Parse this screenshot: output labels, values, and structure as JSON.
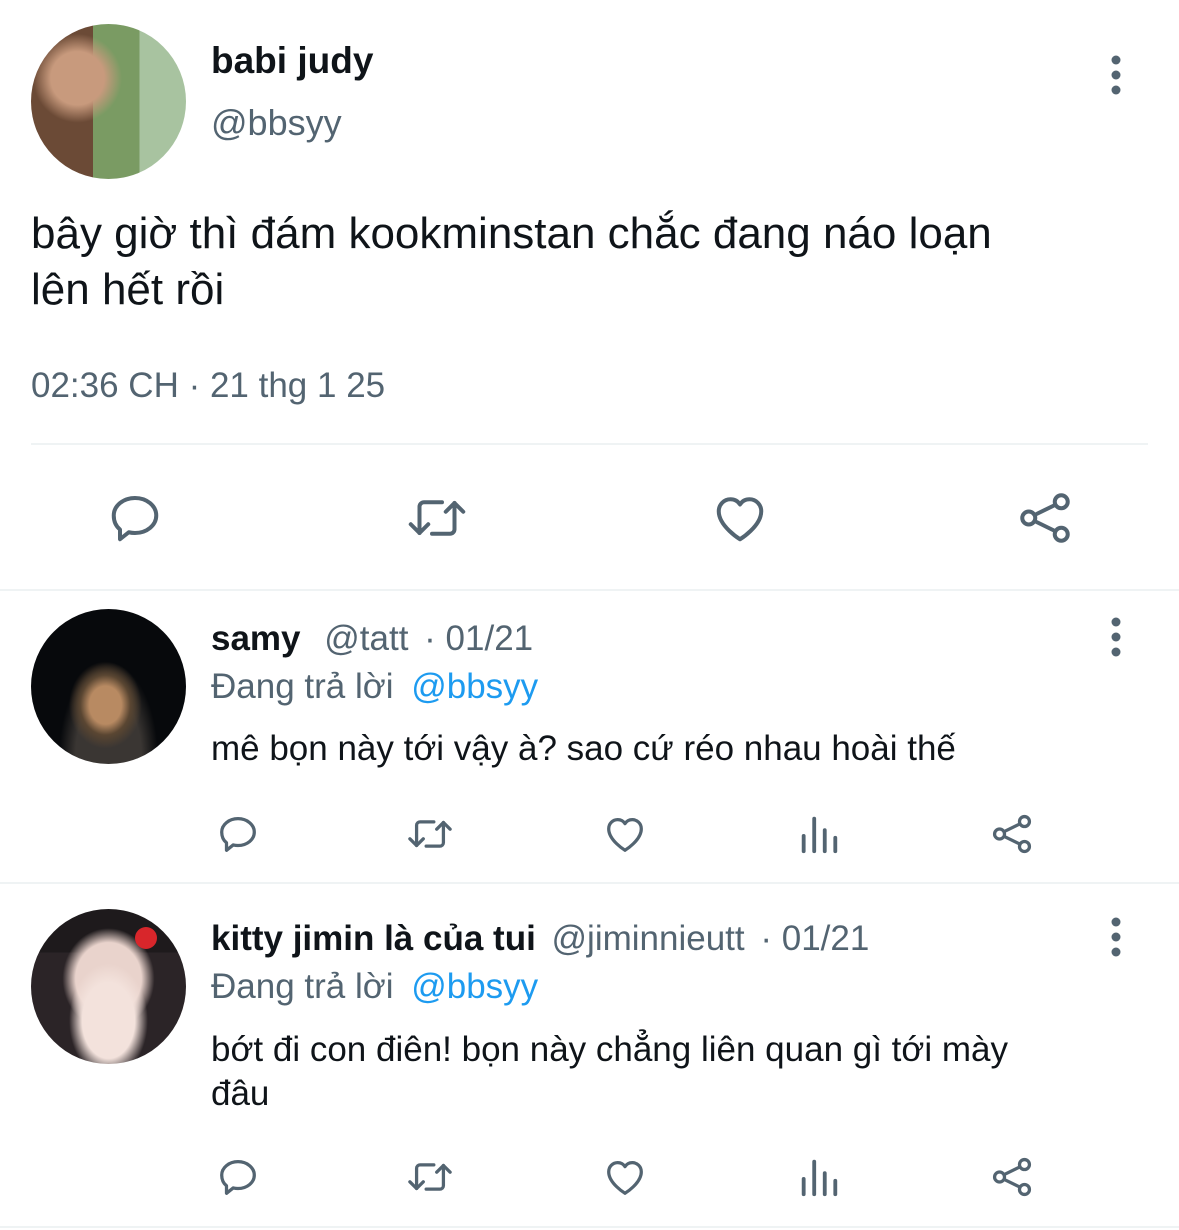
{
  "main_tweet": {
    "display_name": "babi judy",
    "handle": "@bbsyy",
    "text_line1": "bây giờ thì đám kookminstan chắc đang náo loạn",
    "text_line2": "lên hết rồi",
    "timestamp": "02:36 CH · 21 thg 1 25"
  },
  "replies": [
    {
      "display_name": "samy",
      "handle": "@tatt",
      "date": "· 01/21",
      "replying_prefix": "Đang trả lời",
      "replying_to": "@bbsyy",
      "text_line1": "mê bọn này tới vậy à? sao cứ réo nhau hoài thế",
      "text_line2": ""
    },
    {
      "display_name": "kitty jimin là của tui",
      "handle": "@jiminnieutt",
      "date": "· 01/21",
      "replying_prefix": "Đang trả lời",
      "replying_to": "@bbsyy",
      "text_line1": "bớt đi con điên! bọn này chẳng liên quan gì tới mày",
      "text_line2": "đâu"
    }
  ],
  "icons": {
    "reply": "reply-icon",
    "retweet": "retweet-icon",
    "like": "heart-icon",
    "views": "views-icon",
    "share": "share-icon",
    "more": "more-icon"
  },
  "colors": {
    "icon": "#536471",
    "link": "#1d9bf0",
    "divider": "#eff3f4"
  }
}
